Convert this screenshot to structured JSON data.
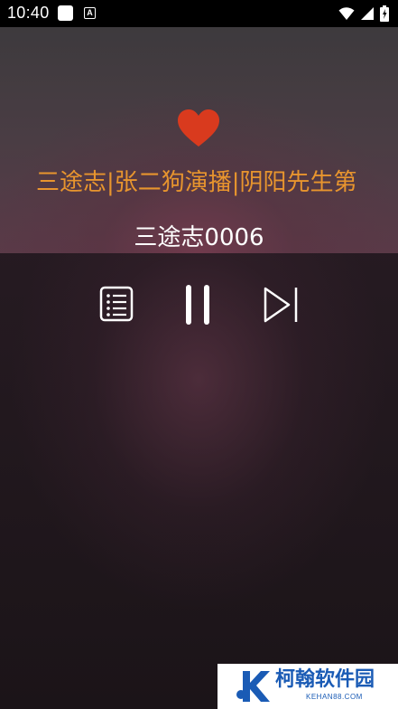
{
  "status_bar": {
    "time": "10:40",
    "icons": [
      "note-icon",
      "a-icon",
      "wifi-icon",
      "signal-icon",
      "battery-icon"
    ]
  },
  "player": {
    "favorite_icon": "heart-icon",
    "favorite_color": "#d93a1e",
    "album_title": "三途志|张二狗演播|阴阳先生第",
    "album_title_color": "#e8952e",
    "track_title": "三途志0006",
    "controls": {
      "playlist_icon": "playlist-icon",
      "pause_icon": "pause-icon",
      "next_icon": "skip-next-icon"
    }
  },
  "watermark": {
    "brand": "柯翰软件园",
    "domain": "KEHAN88.COM"
  }
}
